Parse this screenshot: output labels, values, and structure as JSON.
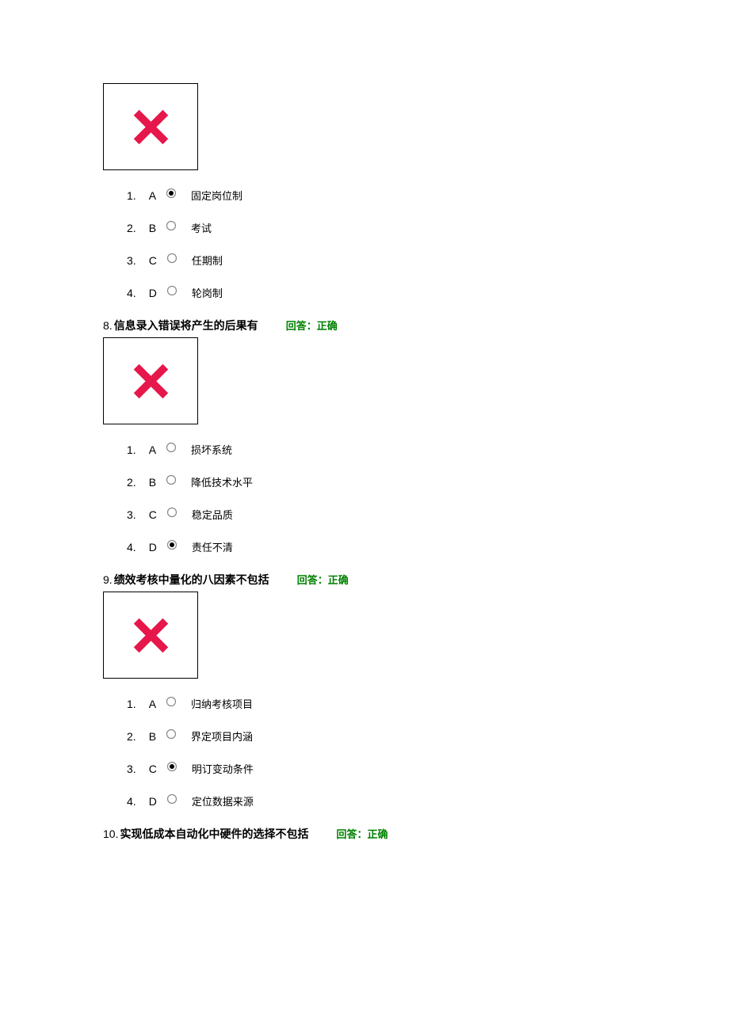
{
  "questions": [
    {
      "options": [
        {
          "num": "1.",
          "letter": "A",
          "selected": true,
          "text": "固定岗位制"
        },
        {
          "num": "2.",
          "letter": "B",
          "selected": false,
          "text": "考试"
        },
        {
          "num": "3.",
          "letter": "C",
          "selected": false,
          "text": "任期制"
        },
        {
          "num": "4.",
          "letter": "D",
          "selected": false,
          "text": "轮岗制"
        }
      ]
    },
    {
      "number": "8.",
      "text": "信息录入错误将产生的后果有",
      "status": "回答：正确",
      "options": [
        {
          "num": "1.",
          "letter": "A",
          "selected": false,
          "text": "损坏系统"
        },
        {
          "num": "2.",
          "letter": "B",
          "selected": false,
          "text": "降低技术水平"
        },
        {
          "num": "3.",
          "letter": "C",
          "selected": false,
          "text": "稳定品质"
        },
        {
          "num": "4.",
          "letter": "D",
          "selected": true,
          "text": "责任不清"
        }
      ]
    },
    {
      "number": "9.",
      "text": "绩效考核中量化的八因素不包括",
      "status": "回答：正确",
      "options": [
        {
          "num": "1.",
          "letter": "A",
          "selected": false,
          "text": "归纳考核项目"
        },
        {
          "num": "2.",
          "letter": "B",
          "selected": false,
          "text": "界定项目内涵"
        },
        {
          "num": "3.",
          "letter": "C",
          "selected": true,
          "text": "明订变动条件"
        },
        {
          "num": "4.",
          "letter": "D",
          "selected": false,
          "text": "定位数据来源"
        }
      ]
    },
    {
      "number": "10.",
      "text": "实现低成本自动化中硬件的选择不包括",
      "status": "回答：正确"
    }
  ]
}
